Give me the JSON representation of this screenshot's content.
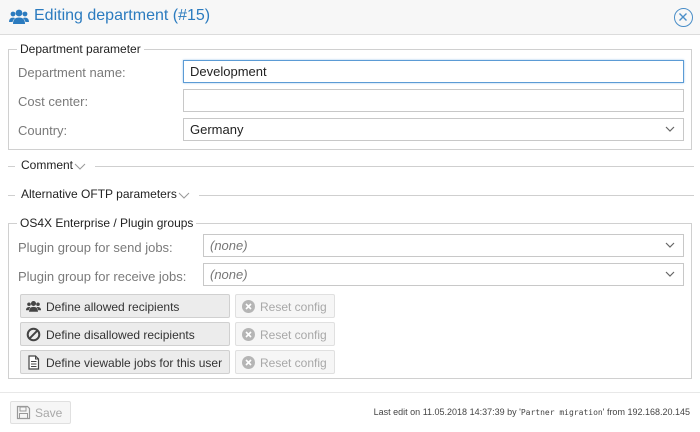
{
  "dialog": {
    "title": "Editing department (#15)",
    "title_icon": "users-icon",
    "close_icon": "close-circle-icon",
    "accent_color": "#2b7bbf"
  },
  "department_parameter": {
    "legend": "Department parameter",
    "name_label": "Department name:",
    "name_value": "Development",
    "cost_center_label": "Cost center:",
    "cost_center_value": "",
    "country_label": "Country:",
    "country_value": "Germany"
  },
  "comment": {
    "label": "Comment"
  },
  "oftp": {
    "label": "Alternative OFTP parameters"
  },
  "plugin_groups": {
    "legend": "OS4X Enterprise / Plugin groups",
    "send_label": "Plugin group for send jobs:",
    "send_value": "(none)",
    "receive_label": "Plugin group for receive jobs:",
    "receive_value": "(none)",
    "buttons": [
      {
        "label": "Define allowed recipients",
        "icon": "users-icon",
        "reset_label": "Reset config"
      },
      {
        "label": "Define disallowed recipients",
        "icon": "ban-icon",
        "reset_label": "Reset config"
      },
      {
        "label": "Define viewable jobs for this user",
        "icon": "document-icon",
        "reset_label": "Reset config"
      }
    ]
  },
  "footer": {
    "save_label": "Save",
    "save_icon": "floppy-icon",
    "last_edit_prefix": "Last edit on 11.05.2018 14:37:39 by '",
    "last_edit_user": "Partner migration",
    "last_edit_suffix": "' from 192.168.20.145"
  }
}
